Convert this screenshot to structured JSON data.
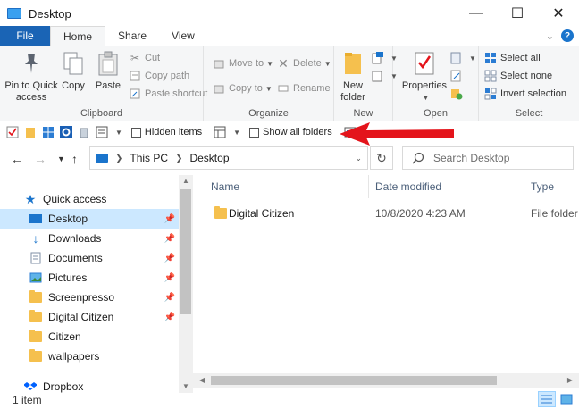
{
  "window": {
    "title": "Desktop"
  },
  "tabs": [
    {
      "label": "File"
    },
    {
      "label": "Home"
    },
    {
      "label": "Share"
    },
    {
      "label": "View"
    }
  ],
  "ribbon": {
    "clipboard": {
      "label": "Clipboard",
      "pin_quick_access": "Pin to Quick access",
      "copy": "Copy",
      "paste": "Paste",
      "cut": "Cut",
      "copy_path": "Copy path",
      "paste_shortcut": "Paste shortcut"
    },
    "organize": {
      "label": "Organize",
      "move_to": "Move to",
      "copy_to": "Copy to",
      "delete": "Delete",
      "rename": "Rename"
    },
    "new": {
      "label": "New",
      "new_folder": "New folder"
    },
    "open": {
      "label": "Open",
      "properties": "Properties"
    },
    "select": {
      "label": "Select",
      "select_all": "Select all",
      "select_none": "Select none",
      "invert_selection": "Invert selection"
    }
  },
  "qat": {
    "hidden_items": "Hidden items",
    "show_all_folders": "Show all folders"
  },
  "address": {
    "crumbs": [
      "This PC",
      "Desktop"
    ]
  },
  "search": {
    "placeholder": "Search Desktop"
  },
  "nav": {
    "items": [
      {
        "label": "Quick access",
        "pinned": false
      },
      {
        "label": "Desktop",
        "pinned": true
      },
      {
        "label": "Downloads",
        "pinned": true
      },
      {
        "label": "Documents",
        "pinned": true
      },
      {
        "label": "Pictures",
        "pinned": true
      },
      {
        "label": "Screenpresso",
        "pinned": true
      },
      {
        "label": "Digital Citizen",
        "pinned": true
      },
      {
        "label": "Citizen",
        "pinned": false
      },
      {
        "label": "wallpapers",
        "pinned": false
      },
      {
        "label": "Dropbox",
        "pinned": false
      }
    ]
  },
  "columns": {
    "name": "Name",
    "date_modified": "Date modified",
    "type": "Type"
  },
  "files": [
    {
      "name": "Digital Citizen",
      "date": "10/8/2020 4:23 AM",
      "type": "File folder"
    }
  ],
  "status": {
    "count": "1 item"
  },
  "colors": {
    "accent": "#1a64b5",
    "selection": "#cce8ff",
    "folder": "#f5c04e",
    "arrow": "#e4141b"
  }
}
